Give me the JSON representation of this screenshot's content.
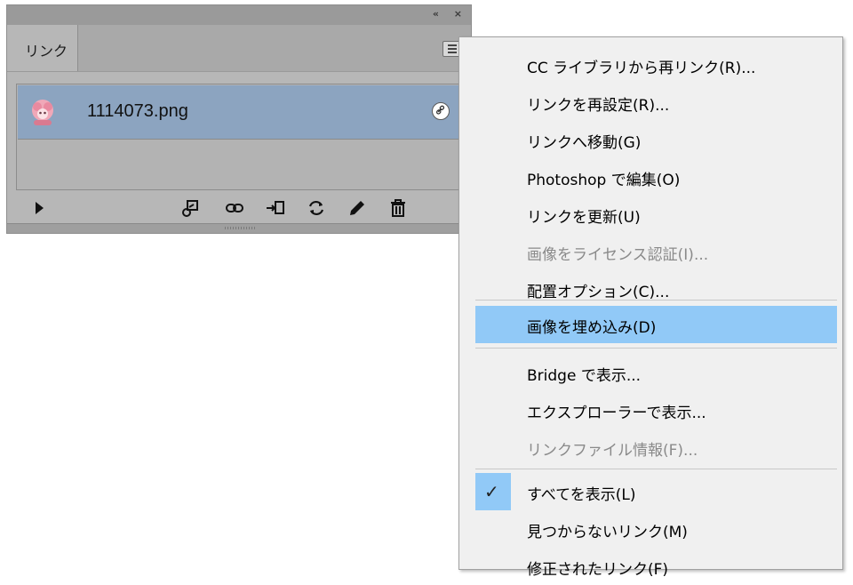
{
  "panel": {
    "tab_label": "リンク",
    "collapse_glyph": "«",
    "close_glyph": "×",
    "file": {
      "name": "1114073.png"
    },
    "toolbar": {
      "tools": [
        "play-icon",
        "relink-from-cc-icon",
        "relink-icon",
        "go-to-link-icon",
        "update-link-icon",
        "edit-original-icon",
        "delete-icon"
      ]
    }
  },
  "menu": {
    "items": [
      {
        "label": "CC ライブラリから再リンク(R)...",
        "state": "normal"
      },
      {
        "label": "リンクを再設定(R)...",
        "state": "normal"
      },
      {
        "label": "リンクへ移動(G)",
        "state": "normal"
      },
      {
        "label": "Photoshop で編集(O)",
        "state": "normal"
      },
      {
        "label": "リンクを更新(U)",
        "state": "normal"
      },
      {
        "label": "画像をライセンス認証(I)...",
        "state": "disabled"
      },
      {
        "label": "配置オプション(C)...",
        "state": "normal"
      },
      {
        "label": "画像を埋め込み(D)",
        "state": "highlight"
      },
      {
        "label": "Bridge で表示...",
        "state": "normal"
      },
      {
        "label": "エクスプローラーで表示...",
        "state": "normal"
      },
      {
        "label": "リンクファイル情報(F)...",
        "state": "disabled"
      },
      {
        "label": "すべてを表示(L)",
        "state": "checked"
      },
      {
        "label": "見つからないリンク(M)",
        "state": "normal"
      },
      {
        "label": "修正されたリンク(F)",
        "state": "normal"
      }
    ]
  },
  "colors": {
    "selection": "#8ca4c0",
    "menu_highlight": "#91c9f7",
    "panel_bg": "#b7b7b7",
    "menu_bg": "#f0f0f0"
  }
}
